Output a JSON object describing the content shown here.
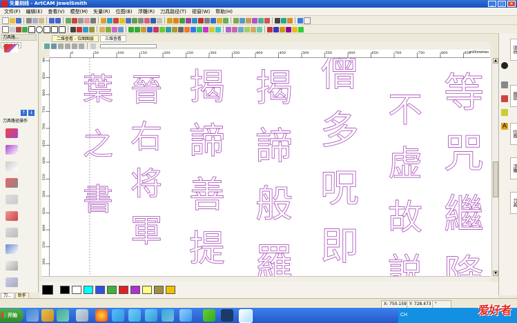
{
  "window": {
    "title": "矢量刻线 - ArtCAM JewelSmith"
  },
  "menu": [
    "文件(F)",
    "编辑(E)",
    "查看(V)",
    "模型(M)",
    "矢量(R)",
    "位图(B)",
    "浮雕(R)",
    "刀具路径(T)",
    "视窗(W)",
    "帮助(H)"
  ],
  "left_panel": {
    "title": "刀具路...",
    "tabs": [
      "2D",
      "3D"
    ],
    "section_label": "刀具路径操作",
    "bottom_tabs": [
      "刀...",
      "助手"
    ]
  },
  "doc_tabs": [
    "二维查看 - 位图图层",
    "三维查看"
  ],
  "hruler_ticks": [
    "0",
    "50",
    "100",
    "150",
    "200",
    "250",
    "300",
    "350",
    "400",
    "450",
    "500",
    "550",
    "600",
    "650",
    "700",
    "750",
    "800",
    "850"
  ],
  "vruler_ticks": [
    "900",
    "850",
    "800",
    "750",
    "700",
    "650",
    "600",
    "550",
    "500",
    "450",
    "400",
    "350",
    "300"
  ],
  "ruler_unit": "millimetres",
  "artwork": {
    "columns": [
      {
        "chars": "葉之書",
        "top": "之"
      },
      {
        "chars": "晉右将軍"
      },
      {
        "chars": "揭諦善提"
      },
      {
        "chars": "揭諦般羅"
      },
      {
        "chars": "僧多呪即"
      },
      {
        "chars": "不虚故説"
      },
      {
        "chars": "等咒繼降"
      }
    ],
    "stroke_color": "#b060c0"
  },
  "palette": {
    "colors": [
      "#000000",
      "#ffffff",
      "#00ffff",
      "#3050e0",
      "#40b040",
      "#e02020",
      "#b030d0",
      "#ffff80",
      "#a09040",
      "#f0c000"
    ]
  },
  "status": {
    "x": "X: 750.159",
    "y": "Y: 728.473",
    "extra": "\""
  },
  "taskbar": {
    "start": "开始",
    "lang": "CH",
    "watermark": "爱好者"
  }
}
